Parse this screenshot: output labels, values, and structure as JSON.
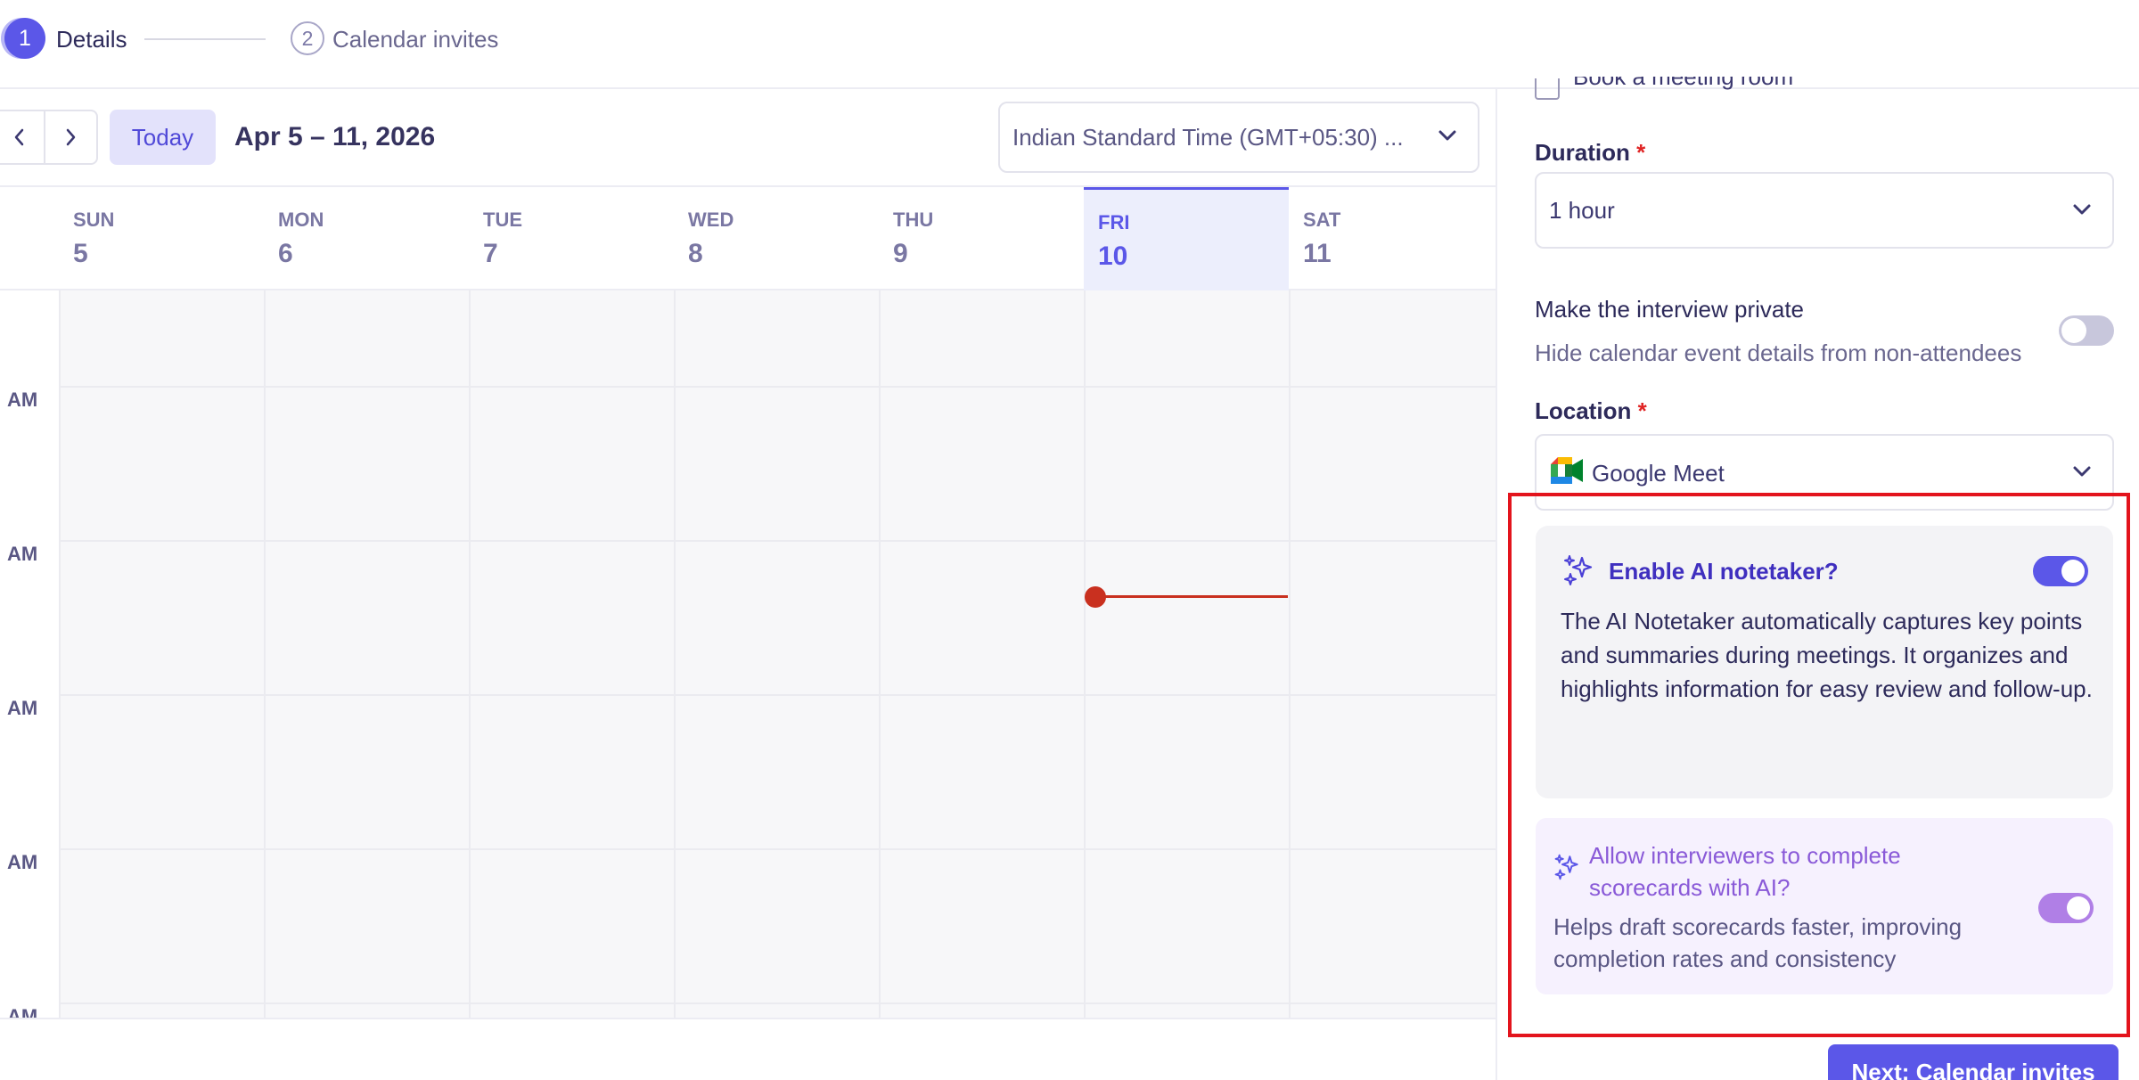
{
  "stepper": {
    "steps": [
      {
        "number": "1",
        "label": "Details",
        "state": "active"
      },
      {
        "number": "2",
        "label": "Calendar invites",
        "state": "upcoming"
      }
    ]
  },
  "toolbar": {
    "prev_icon": "chevron-left-icon",
    "next_icon": "chevron-right-icon",
    "today_label": "Today",
    "date_range": "Apr 5 – 11, 2026",
    "timezone": "Indian Standard Time (GMT+05:30) ..."
  },
  "calendar": {
    "days": [
      {
        "name": "SUN",
        "num": "5"
      },
      {
        "name": "MON",
        "num": "6"
      },
      {
        "name": "TUE",
        "num": "7"
      },
      {
        "name": "WED",
        "num": "8"
      },
      {
        "name": "THU",
        "num": "9"
      },
      {
        "name": "FRI",
        "num": "10",
        "today": true
      },
      {
        "name": "SAT",
        "num": "11"
      }
    ],
    "time_labels": [
      "AM",
      "AM",
      "AM",
      "AM",
      "AM"
    ]
  },
  "form": {
    "meeting_room_label": "Book a meeting room",
    "duration": {
      "label": "Duration",
      "required": "*",
      "value": "1 hour"
    },
    "private": {
      "title": "Make the interview private",
      "description": "Hide calendar event details from non-attendees",
      "enabled": false
    },
    "location": {
      "label": "Location",
      "required": "*",
      "value": "Google Meet"
    },
    "ai_notetaker": {
      "title": "Enable AI notetaker?",
      "description": "The AI Notetaker automatically captures key points and summaries during meetings. It organizes and highlights information for easy review and follow-up.",
      "enabled": true
    },
    "ai_scorecards": {
      "title": "Allow interviewers to complete scorecards with AI?",
      "description": "Helps draft scorecards faster, improving completion rates and consistency",
      "enabled": true
    },
    "next_button": "Next: Calendar invites"
  },
  "colors": {
    "accent": "#5b57e8",
    "today_bg": "#eceefc",
    "now_indicator": "#c9301f",
    "highlight_border": "#e3141d",
    "required": "#e02424"
  }
}
